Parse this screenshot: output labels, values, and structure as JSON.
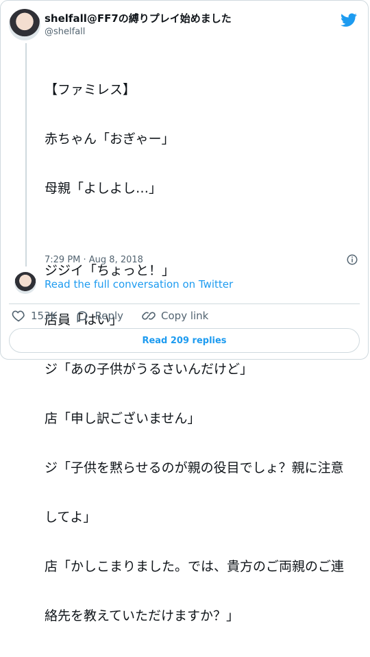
{
  "author": {
    "name": "shelfall@FF7の縛りプレイ始めました",
    "handle": "@shelfall",
    "avatar_icon": "user-avatar"
  },
  "tweet": {
    "text_lines": [
      "【ファミレス】",
      "赤ちゃん「おぎゃー」",
      "母親「よしよし…」",
      "",
      "ジジイ「ちょっと！」",
      "店員「はい」",
      "ジ「あの子供がうるさいんだけど」",
      "店「申し訳ございません」",
      "ジ「子供を黙らせるのが親の役目でしょ？親に注意",
      "してよ」",
      "店「かしこまりました。では、貴方のご両親のご連",
      "絡先を教えていただけますか？」"
    ],
    "timestamp": "7:29 PM · Aug 8, 2018"
  },
  "conversation": {
    "link_text": "Read the full conversation on Twitter"
  },
  "actions": {
    "likes": "153K",
    "reply_label": "Reply",
    "copy_label": "Copy link"
  },
  "footer": {
    "read_replies": "Read 209 replies"
  },
  "colors": {
    "accent": "#1d9bf0",
    "border": "#cfd9de",
    "muted": "#536471",
    "text": "#0f1419"
  },
  "icons": {
    "brand": "twitter-bird-icon",
    "info": "info-icon",
    "like": "heart-icon",
    "reply": "reply-icon",
    "copy": "link-icon"
  }
}
